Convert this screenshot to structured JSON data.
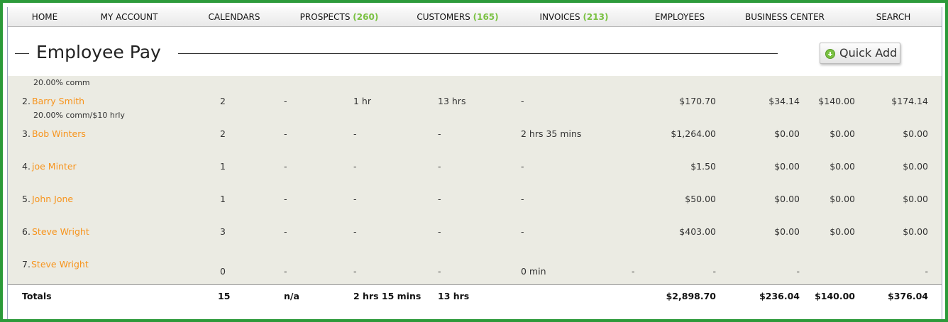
{
  "nav": {
    "items": [
      {
        "label": "HOME",
        "count": ""
      },
      {
        "label": "MY ACCOUNT",
        "count": ""
      },
      {
        "label": "CALENDARS",
        "count": ""
      },
      {
        "label": "PROSPECTS",
        "count": "(260)"
      },
      {
        "label": "CUSTOMERS",
        "count": "(165)"
      },
      {
        "label": "INVOICES",
        "count": "(213)"
      },
      {
        "label": "EMPLOYEES",
        "count": ""
      },
      {
        "label": "BUSINESS CENTER",
        "count": ""
      },
      {
        "label": "SEARCH",
        "count": ""
      }
    ]
  },
  "header": {
    "title": "Employee Pay",
    "quick_add_label": "Quick Add"
  },
  "rows": [
    {
      "num": "",
      "name": "",
      "note": "20.00% comm",
      "c1": "",
      "c2": "",
      "c3": "",
      "c4": "",
      "c5": "",
      "c6": "",
      "c7": "",
      "c8": "",
      "c9": "",
      "c10": ""
    },
    {
      "num": "2.",
      "name": "Barry Smith",
      "note": "20.00% comm/$10 hrly",
      "c1": "2",
      "c2": "-",
      "c3": "1 hr",
      "c4": "13 hrs",
      "c5": "-",
      "c6": "",
      "c7": "$170.70",
      "c8": "$34.14",
      "c9": "$140.00",
      "c10": "$174.14"
    },
    {
      "num": "3.",
      "name": "Bob Winters",
      "note": "",
      "c1": "2",
      "c2": "-",
      "c3": "-",
      "c4": "-",
      "c5": "2 hrs 35 mins",
      "c6": "",
      "c7": "$1,264.00",
      "c8": "$0.00",
      "c9": "$0.00",
      "c10": "$0.00"
    },
    {
      "num": "4.",
      "name": "joe Minter",
      "note": "",
      "c1": "1",
      "c2": "-",
      "c3": "-",
      "c4": "-",
      "c5": "-",
      "c6": "",
      "c7": "$1.50",
      "c8": "$0.00",
      "c9": "$0.00",
      "c10": "$0.00"
    },
    {
      "num": "5.",
      "name": "John Jone",
      "note": "",
      "c1": "1",
      "c2": "-",
      "c3": "-",
      "c4": "-",
      "c5": "-",
      "c6": "",
      "c7": "$50.00",
      "c8": "$0.00",
      "c9": "$0.00",
      "c10": "$0.00"
    },
    {
      "num": "6.",
      "name": "Steve Wright",
      "note": "",
      "c1": "3",
      "c2": "-",
      "c3": "-",
      "c4": "-",
      "c5": "-",
      "c6": "",
      "c7": "$403.00",
      "c8": "$0.00",
      "c9": "$0.00",
      "c10": "$0.00"
    },
    {
      "num": "7.",
      "name": "Steve Wright",
      "note": "",
      "c1": "0",
      "c2": "-",
      "c3": "-",
      "c4": "-",
      "c5": "0 min",
      "c6": "-",
      "c7": "-",
      "c8": "-",
      "c9": "",
      "c10": "-"
    }
  ],
  "totals": {
    "label": "Totals",
    "c1": "15",
    "c2": "n/a",
    "c3": "2 hrs 15 mins",
    "c4": "13 hrs",
    "c7": "$2,898.70",
    "c8": "$236.04",
    "c9": "$140.00",
    "c10": "$376.04"
  },
  "colors": {
    "accent_orange": "#f7941d",
    "count_green": "#7ac142",
    "frame_green": "#2c9a3a",
    "row_bg": "#ebebe3"
  }
}
